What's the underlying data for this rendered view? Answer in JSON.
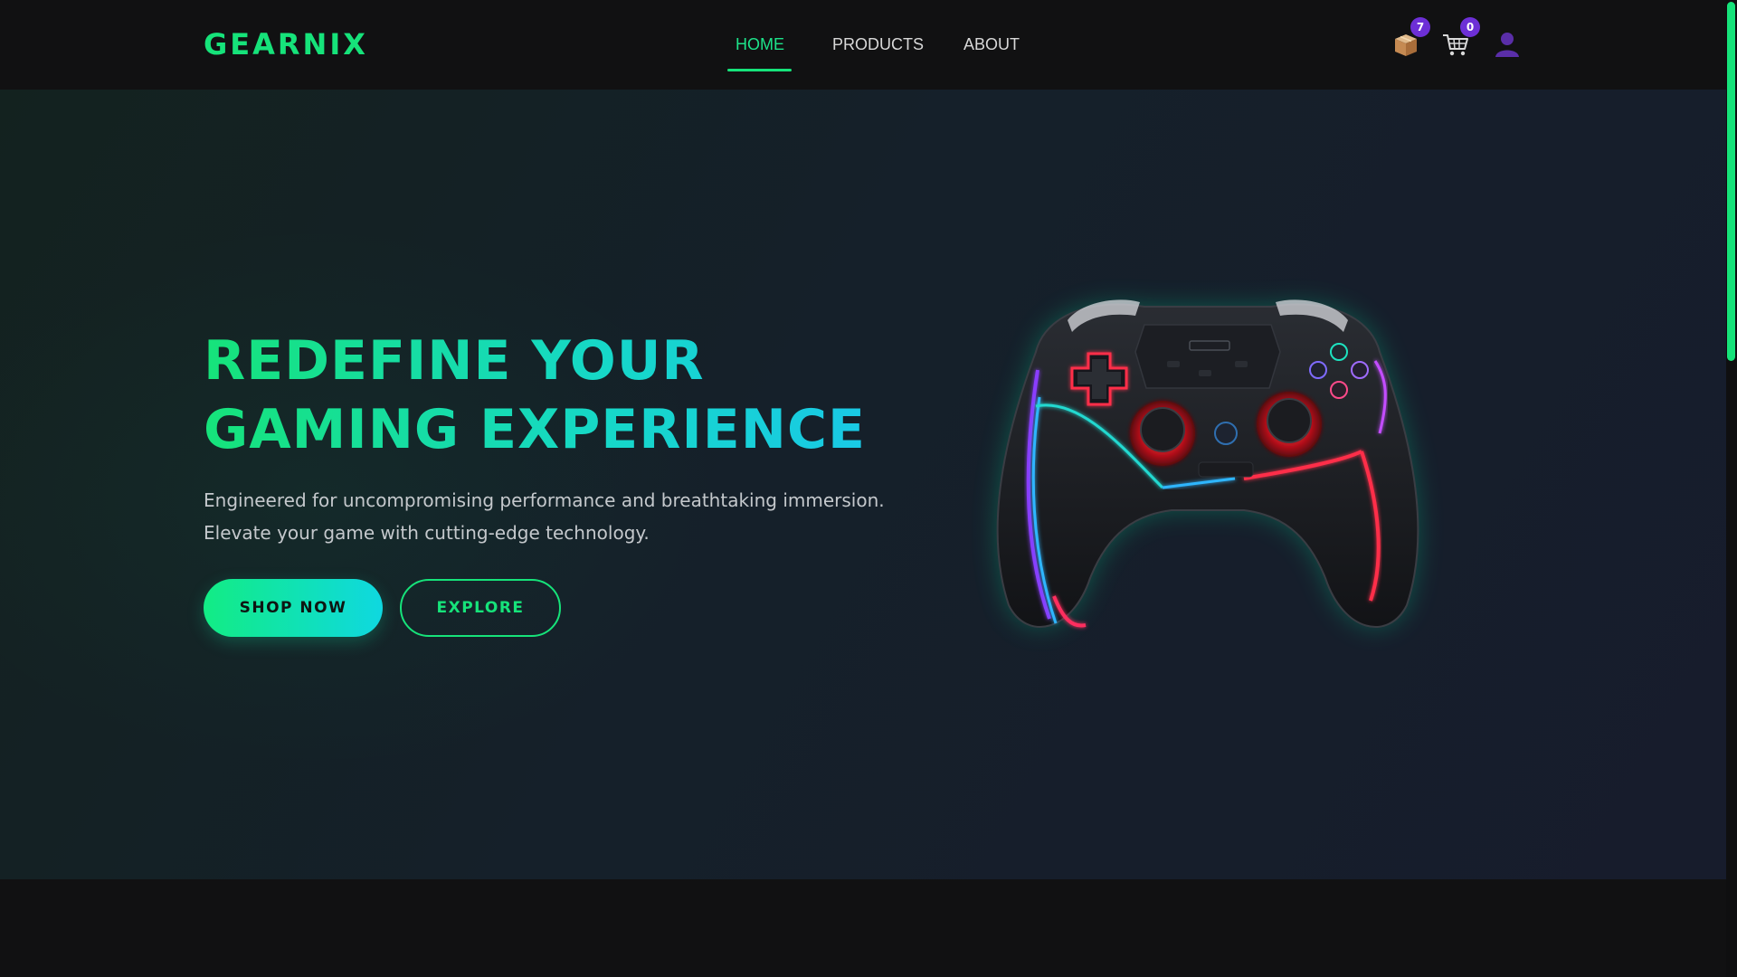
{
  "brand": {
    "logo": "GEARNIX",
    "accent": "#16e37a",
    "accent2": "#19c9e6",
    "badge_color": "#6d2fd6"
  },
  "nav": {
    "links": [
      {
        "label": "HOME",
        "active": true
      },
      {
        "label": "PRODUCTS",
        "active": false
      },
      {
        "label": "ABOUT",
        "active": false
      }
    ],
    "icons": [
      {
        "name": "package-icon",
        "badge": "7"
      },
      {
        "name": "cart-icon",
        "badge": "0"
      },
      {
        "name": "user-icon"
      }
    ]
  },
  "hero": {
    "headline": [
      "REDEFINE YOUR",
      "GAMING EXPERIENCE"
    ],
    "subtitle": [
      "Engineered for uncompromising performance and breathtaking immersion.",
      "Elevate your game with cutting-edge technology."
    ],
    "primary_cta": "SHOP NOW",
    "secondary_cta": "EXPLORE",
    "image": "rgb-gamepad-controller"
  }
}
